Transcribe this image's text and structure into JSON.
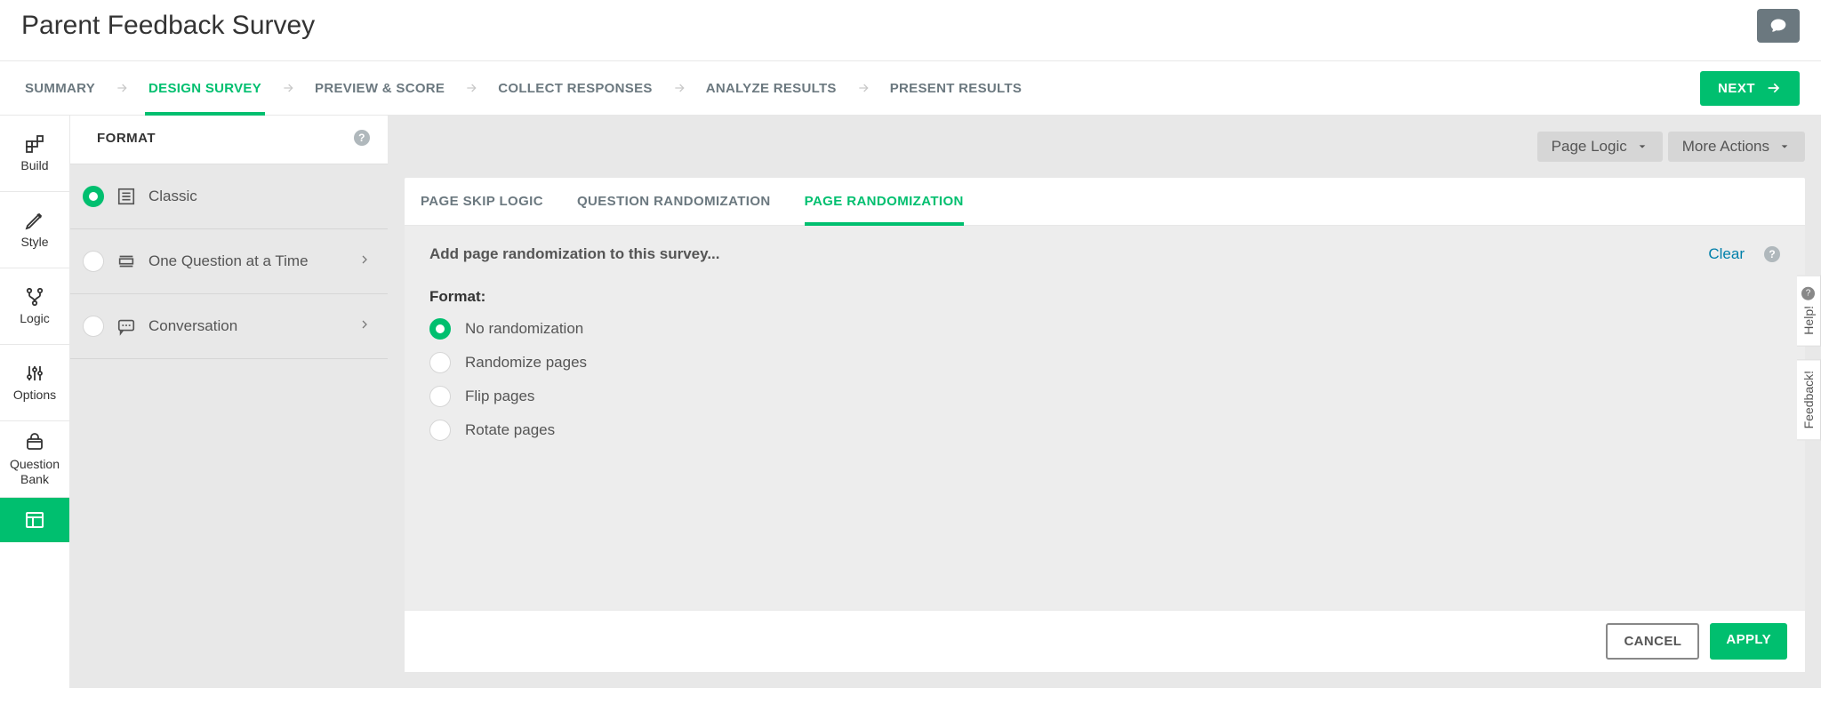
{
  "header": {
    "title": "Parent Feedback Survey"
  },
  "nav": {
    "tabs": [
      {
        "label": "SUMMARY"
      },
      {
        "label": "DESIGN SURVEY"
      },
      {
        "label": "PREVIEW & SCORE"
      },
      {
        "label": "COLLECT RESPONSES"
      },
      {
        "label": "ANALYZE RESULTS"
      },
      {
        "label": "PRESENT RESULTS"
      }
    ],
    "next": "NEXT"
  },
  "rail": {
    "items": [
      {
        "label": "Build"
      },
      {
        "label": "Style"
      },
      {
        "label": "Logic"
      },
      {
        "label": "Options"
      },
      {
        "label": "Question Bank"
      }
    ]
  },
  "formatPanel": {
    "heading": "FORMAT",
    "options": [
      {
        "label": "Classic"
      },
      {
        "label": "One Question at a Time"
      },
      {
        "label": "Conversation"
      }
    ]
  },
  "content": {
    "pageLogic": "Page Logic",
    "moreActions": "More Actions",
    "tabs": [
      {
        "label": "PAGE SKIP LOGIC"
      },
      {
        "label": "QUESTION RANDOMIZATION"
      },
      {
        "label": "PAGE RANDOMIZATION"
      }
    ],
    "desc": "Add page randomization to this survey...",
    "clear": "Clear",
    "formatLabel": "Format:",
    "radios": [
      {
        "label": "No randomization"
      },
      {
        "label": "Randomize pages"
      },
      {
        "label": "Flip pages"
      },
      {
        "label": "Rotate pages"
      }
    ],
    "cancel": "CANCEL",
    "apply": "APPLY"
  },
  "sideTabs": {
    "help": "Help!",
    "feedback": "Feedback!"
  }
}
